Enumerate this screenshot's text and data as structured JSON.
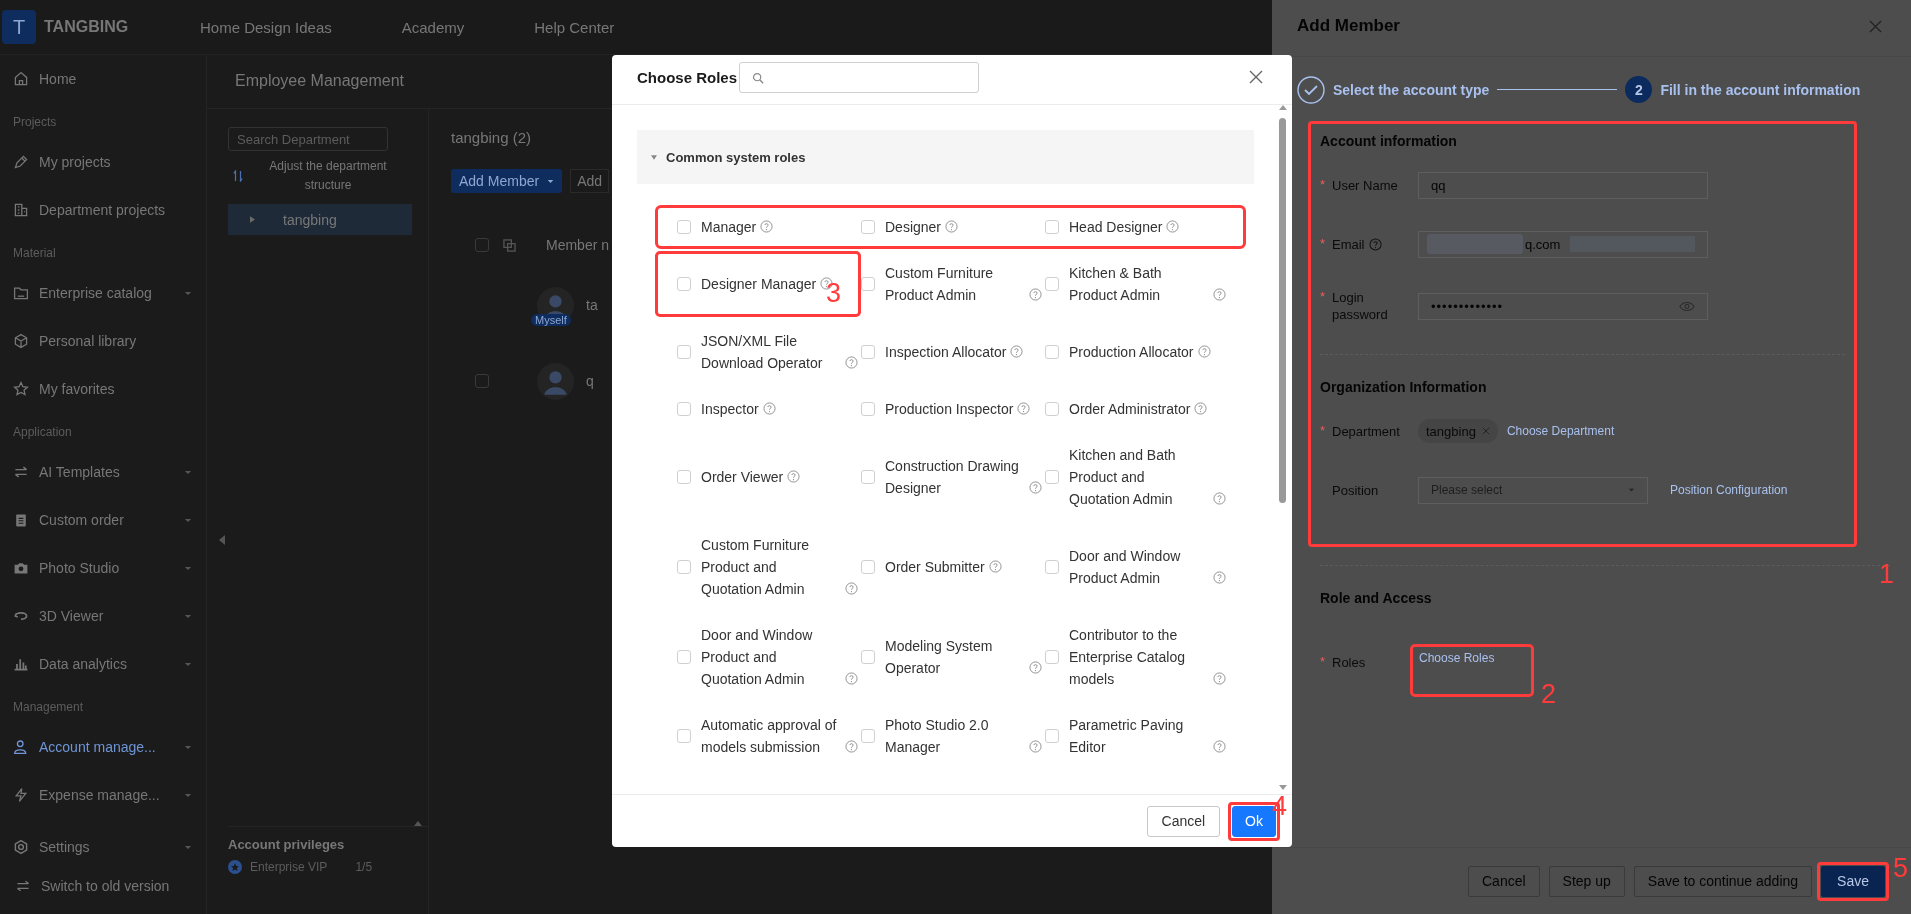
{
  "top_bar": {
    "logo_letter": "T",
    "brand": "TANGBING",
    "nav": [
      "Home Design Ideas",
      "Academy",
      "Help Center"
    ]
  },
  "sidebar": {
    "items": [
      {
        "kind": "item",
        "label": "Home",
        "expandable": false,
        "selected": false
      },
      {
        "kind": "section",
        "label": "Projects"
      },
      {
        "kind": "item",
        "label": "My projects",
        "expandable": false,
        "selected": false
      },
      {
        "kind": "item",
        "label": "Department projects",
        "expandable": false,
        "selected": false
      },
      {
        "kind": "section",
        "label": "Material"
      },
      {
        "kind": "item",
        "label": "Enterprise catalog",
        "expandable": true,
        "selected": false
      },
      {
        "kind": "item",
        "label": "Personal library",
        "expandable": false,
        "selected": false
      },
      {
        "kind": "item",
        "label": "My favorites",
        "expandable": false,
        "selected": false
      },
      {
        "kind": "section",
        "label": "Application"
      },
      {
        "kind": "item",
        "label": "AI Templates",
        "expandable": true,
        "selected": false
      },
      {
        "kind": "item",
        "label": "Custom order",
        "expandable": true,
        "selected": false
      },
      {
        "kind": "item",
        "label": "Photo Studio",
        "expandable": true,
        "selected": false
      },
      {
        "kind": "item",
        "label": "3D Viewer",
        "expandable": true,
        "selected": false
      },
      {
        "kind": "item",
        "label": "Data analytics",
        "expandable": true,
        "selected": false
      },
      {
        "kind": "section",
        "label": "Management"
      },
      {
        "kind": "item",
        "label": "Account manage...",
        "expandable": true,
        "selected": true
      },
      {
        "kind": "item",
        "label": "Expense manage...",
        "expandable": true,
        "selected": false
      }
    ],
    "settings": {
      "label": "Settings",
      "expandable": true,
      "selected": false
    },
    "switch_link": "Switch to old version"
  },
  "content": {
    "title": "Employee Management",
    "department_search": {
      "placeholder": "Search Department"
    },
    "adjust_link": "Adjust the department structure",
    "departments": [
      {
        "label": "tangbing",
        "selected": true
      }
    ],
    "dept_heading": "tangbing (2)",
    "add_member_button": "Add Member",
    "second_button": "Add",
    "table": {
      "all_checked": false,
      "columns": [
        "Member n"
      ],
      "rows": [
        {
          "name": "ta",
          "badge": "Myself"
        },
        {
          "name": "q",
          "checked": false
        }
      ]
    },
    "privileges": {
      "title": "Account privileges",
      "items": [
        {
          "label": "Enterprise VIP",
          "count": "1/5"
        }
      ]
    }
  },
  "dialog": {
    "title": "Choose Roles",
    "group": {
      "label": "Common system roles",
      "expanded": true
    },
    "role_rows": [
      {
        "highlighted": true,
        "roles": [
          {
            "label": "Manager",
            "checked": false,
            "highlighted": false
          },
          {
            "label": "Designer",
            "checked": false,
            "highlighted": false
          },
          {
            "label": "Head Designer",
            "checked": false,
            "highlighted": false
          }
        ]
      },
      {
        "highlighted": false,
        "roles": [
          {
            "label": "Designer Manager",
            "checked": false,
            "highlighted": true,
            "callout": "3"
          },
          {
            "label": "Custom Furniture Product Admin",
            "checked": false,
            "highlighted": false
          },
          {
            "label": "Kitchen & Bath Product Admin",
            "checked": false,
            "highlighted": false
          }
        ]
      },
      {
        "highlighted": false,
        "roles": [
          {
            "label": "JSON/XML File Download Operator",
            "checked": false,
            "highlighted": false
          },
          {
            "label": "Inspection Allocator",
            "checked": false,
            "highlighted": false
          },
          {
            "label": "Production Allocator",
            "checked": false,
            "highlighted": false
          }
        ]
      },
      {
        "highlighted": false,
        "roles": [
          {
            "label": "Inspector",
            "checked": false,
            "highlighted": false
          },
          {
            "label": "Production Inspector",
            "checked": false,
            "highlighted": false
          },
          {
            "label": "Order Administrator",
            "checked": false,
            "highlighted": false
          }
        ]
      },
      {
        "highlighted": false,
        "roles": [
          {
            "label": "Order Viewer",
            "checked": false,
            "highlighted": false
          },
          {
            "label": "Construction Drawing Designer",
            "checked": false,
            "highlighted": false
          },
          {
            "label": "Kitchen and Bath Product and Quotation Admin",
            "checked": false,
            "highlighted": false
          }
        ]
      },
      {
        "highlighted": false,
        "roles": [
          {
            "label": "Custom Furniture Product and Quotation Admin",
            "checked": false,
            "highlighted": false
          },
          {
            "label": "Order Submitter",
            "checked": false,
            "highlighted": false
          },
          {
            "label": "Door and Window Product Admin",
            "checked": false,
            "highlighted": false
          }
        ]
      },
      {
        "highlighted": false,
        "roles": [
          {
            "label": "Door and Window Product and Quotation Admin",
            "checked": false,
            "highlighted": false
          },
          {
            "label": "Modeling System Operator",
            "checked": false,
            "highlighted": false
          },
          {
            "label": "Contributor to the Enterprise Catalog models",
            "checked": false,
            "highlighted": false
          }
        ]
      },
      {
        "highlighted": false,
        "roles": [
          {
            "label": "Automatic approval of models submission",
            "checked": false,
            "highlighted": false
          },
          {
            "label": "Photo Studio 2.0 Manager",
            "checked": false,
            "highlighted": false
          },
          {
            "label": "Parametric Paving Editor",
            "checked": false,
            "highlighted": false
          }
        ]
      }
    ],
    "buttons": [
      {
        "label": "Cancel",
        "kind": "default",
        "highlighted": false
      },
      {
        "label": "Ok",
        "kind": "primary",
        "highlighted": true,
        "callout": "4"
      }
    ]
  },
  "drawer": {
    "title": "Add Member",
    "required_mark": "*",
    "steps": [
      {
        "label": "Select the account type",
        "completed": true
      },
      {
        "label": "Fill in the account information",
        "number": "2",
        "completed": false
      }
    ],
    "groups": [
      {
        "highlighted": true,
        "callout": "1",
        "sections": [
          {
            "title": "Account information",
            "fields": [
              {
                "kind": "text",
                "label": "User Name",
                "required": true,
                "value": "qq"
              },
              {
                "kind": "text",
                "label": "Email",
                "required": true,
                "help": true,
                "redacted": true,
                "value": "q.com"
              },
              {
                "kind": "password",
                "label": "Login password",
                "required": true,
                "value": "•••••••••••••"
              }
            ]
          },
          {
            "title": "Organization Information",
            "fields": [
              {
                "kind": "tags",
                "label": "Department",
                "required": true,
                "tags": [
                  "tangbing"
                ],
                "link": "Choose Department"
              },
              {
                "kind": "select",
                "label": "Position",
                "placeholder": "Please select",
                "link": "Position Configuration"
              }
            ]
          }
        ]
      },
      {
        "highlighted": false,
        "sections": [
          {
            "title": "Role and Access",
            "fields": [
              {
                "kind": "link",
                "label": "Roles",
                "required": true,
                "link": "Choose Roles",
                "link_highlighted": true,
                "callout": "2"
              }
            ]
          }
        ]
      }
    ],
    "buttons": [
      {
        "label": "Cancel",
        "kind": "default",
        "highlighted": false
      },
      {
        "label": "Step up",
        "kind": "default",
        "highlighted": false
      },
      {
        "label": "Save to continue adding",
        "kind": "default",
        "highlighted": false
      },
      {
        "label": "Save",
        "kind": "primary",
        "highlighted": true,
        "callout": "5"
      }
    ]
  }
}
